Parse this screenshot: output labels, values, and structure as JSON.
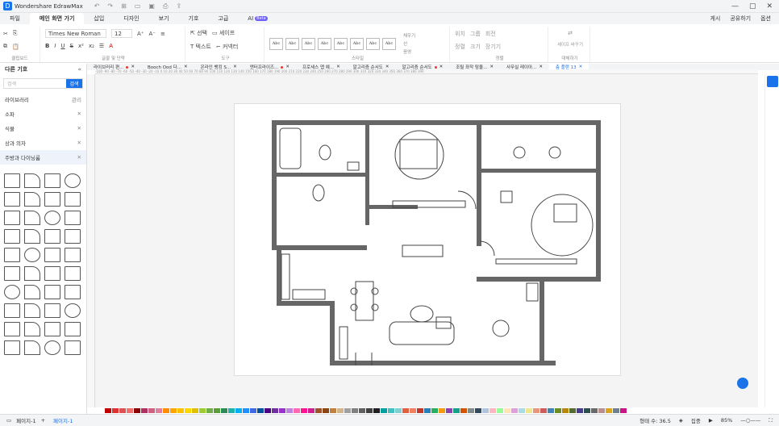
{
  "app": {
    "title": "Wondershare EdrawMax"
  },
  "menu": {
    "tabs": [
      "파일",
      "메인 화면 가기",
      "삽입",
      "디자인",
      "보기",
      "기호",
      "고급",
      "AI"
    ],
    "ai_badge": "Beta",
    "right": [
      "게시",
      "공유하기",
      "옵션"
    ]
  },
  "ribbon": {
    "font_name": "Times New Roman",
    "font_size": "12",
    "groups": [
      "클립보드",
      "글꼴 및 단락",
      "도구",
      "스타일",
      "정렬",
      "대체하기"
    ],
    "tools": {
      "select": "선택",
      "shape": "셰이프",
      "text": "텍스트",
      "connector": "커넥터"
    },
    "style_box_label": "Abc",
    "fill": "채우기",
    "line": "선",
    "shadow": "음영",
    "position": "위치",
    "group": "그룹",
    "rotate": "회전",
    "align": "정렬",
    "size": "크기",
    "distribute": "장기기",
    "replace": "셰이프 바꾸기"
  },
  "left": {
    "title": "다른 기호",
    "search_placeholder": "검색",
    "search_button": "검색",
    "library_label": "라이브러리",
    "manage_label": "관리",
    "libraries": [
      "소파",
      "식물",
      "상과 의자",
      "주방과 다이닝룸"
    ]
  },
  "doc_tabs": [
    {
      "label": "라이브러리 편...",
      "dirty": true
    },
    {
      "label": "Booch Ood 다...",
      "dirty": false
    },
    {
      "label": "온라인 뱅킹 S...",
      "dirty": false
    },
    {
      "label": "엔터프라이즈...",
      "dirty": true
    },
    {
      "label": "프로세스 맵 예...",
      "dirty": false
    },
    {
      "label": "알고리즘 순서도",
      "dirty": false
    },
    {
      "label": "알고리즘 순서도",
      "dirty": true
    },
    {
      "label": "조릴 좌작 탐올...",
      "dirty": false
    },
    {
      "label": "사무실 레이아...",
      "dirty": false
    },
    {
      "label": "층 플랜 13",
      "dirty": false,
      "active": true
    }
  ],
  "ruler": {
    "ticks": "-100 -90 -80 -70 -60 -50 -40 -30 -20 -10 0 10 20 30 40 50 60 70 80 90 100 110 120 130 140 150 160 170 180 190 200 210 220 230 240 250 260 270 280 290 300 310 320 330 340 350 360 370 380 390"
  },
  "palette": [
    "#c00000",
    "#e03030",
    "#e05050",
    "#f07070",
    "#8b0000",
    "#b03060",
    "#d06080",
    "#e080a0",
    "#ff8c00",
    "#ffa500",
    "#ffc000",
    "#ffd700",
    "#e0c000",
    "#9acd32",
    "#70ad47",
    "#5a9e3a",
    "#2e8b57",
    "#20b2aa",
    "#00b0f0",
    "#1e90ff",
    "#4169e1",
    "#0050a0",
    "#4b0082",
    "#7030a0",
    "#9932cc",
    "#c080e0",
    "#ff69b4",
    "#ff1493",
    "#d02090",
    "#a0522d",
    "#8b4513",
    "#c08040",
    "#d2b48c",
    "#a0a0a0",
    "#808080",
    "#606060",
    "#404040",
    "#202020",
    "#00a0a0",
    "#40c0c0",
    "#80d0d0",
    "#e06040",
    "#f08060",
    "#c0392b",
    "#2980b9",
    "#27ae60",
    "#f39c12",
    "#8e44ad",
    "#16a085",
    "#d35400",
    "#7f8c8d",
    "#34495e",
    "#b0c4de",
    "#ffb6c1",
    "#98fb98",
    "#ffe4b5",
    "#dda0dd",
    "#add8e6",
    "#f0e68c",
    "#e9967a",
    "#cd5c5c",
    "#4682b4",
    "#6b8e23",
    "#b8860b",
    "#556b2f",
    "#483d8b",
    "#2f4f4f",
    "#696969",
    "#bc8f8f",
    "#daa520",
    "#708090",
    "#c71585"
  ],
  "status": {
    "page_label": "페이지-1",
    "add": "+",
    "active_page": "페이지-1",
    "shape_count": "형태 수: 36.5",
    "focus": "집중",
    "zoom": "85%"
  }
}
